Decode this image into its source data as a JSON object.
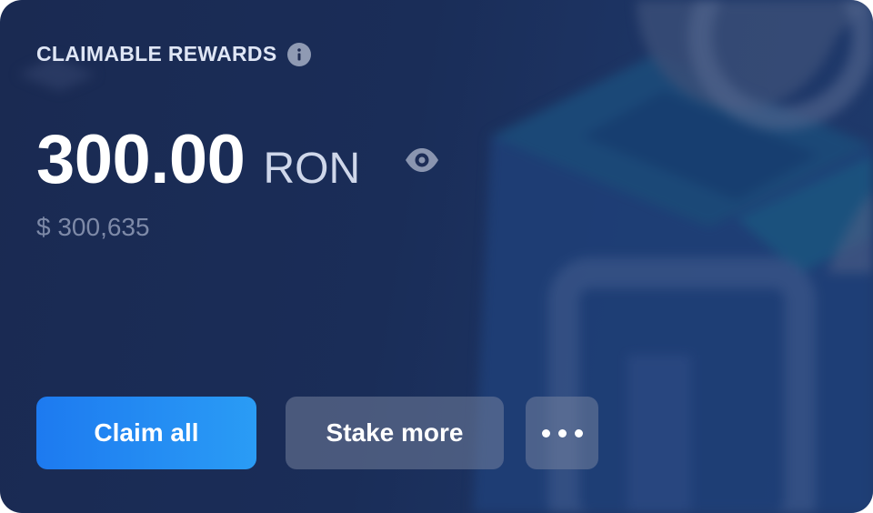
{
  "card": {
    "title": "CLAIMABLE REWARDS",
    "amount": "300.00",
    "unit": "RON",
    "usd_value": "$ 300,635"
  },
  "actions": {
    "claim_label": "Claim all",
    "stake_label": "Stake more"
  },
  "icons": {
    "info": "info-icon",
    "visibility": "eye-icon",
    "more": "more-horizontal-icon"
  },
  "colors": {
    "background": "#1a2a52",
    "primary_button": "#1d7af0",
    "secondary_button": "#5a6788",
    "muted_text": "#7e8aa8"
  }
}
